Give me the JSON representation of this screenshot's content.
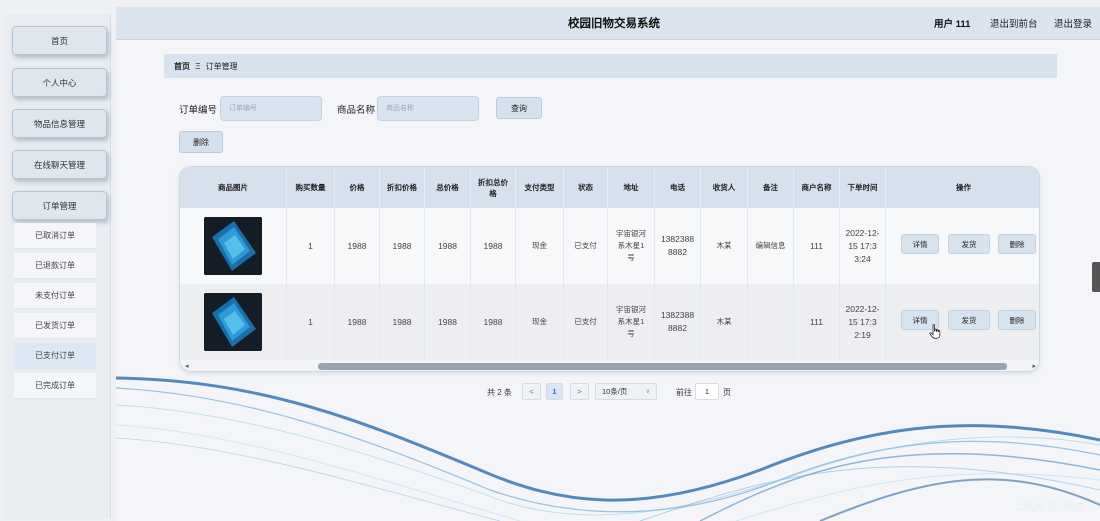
{
  "header": {
    "title": "校园旧物交易系统",
    "user": "用户 111",
    "links": [
      "退出到前台",
      "退出登录"
    ]
  },
  "sidebar": {
    "menus": [
      "首页",
      "个人中心",
      "物品信息管理",
      "在线聊天管理",
      "订单管理"
    ],
    "order_submenu": [
      "已取消订单",
      "已退款订单",
      "未支付订单",
      "已发货订单",
      "已支付订单",
      "已完成订单"
    ],
    "active_submenu": "已支付订单"
  },
  "breadcrumb": {
    "home": "首页",
    "separator": "Ξ",
    "current": "订单管理"
  },
  "search": {
    "order_no_label": "订单编号",
    "order_no_placeholder": "订单编号",
    "product_label": "商品名称",
    "product_placeholder": "商品名称",
    "query_button": "查询",
    "delete_button": "删除"
  },
  "table": {
    "columns": [
      "商品图片",
      "购买数量",
      "价格",
      "折扣价格",
      "总价格",
      "折扣总价格",
      "支付类型",
      "状态",
      "地址",
      "电话",
      "收货人",
      "备注",
      "商户名称",
      "下单时间",
      "操作"
    ],
    "rows": [
      {
        "qty": "1",
        "price": "1988",
        "discount_price": "1988",
        "total": "1988",
        "discount_total": "1988",
        "pay_type": "现金",
        "status": "已支付",
        "address": "宇宙银河系木星1号",
        "phone": "13823888882",
        "receiver": "木某",
        "remark": "编辑信息",
        "merchant": "111",
        "time": "2022-12-15 17:33:24"
      },
      {
        "qty": "1",
        "price": "1988",
        "discount_price": "1988",
        "total": "1988",
        "discount_total": "1988",
        "pay_type": "现金",
        "status": "已支付",
        "address": "宇宙银河系木星1号",
        "phone": "13823888882",
        "receiver": "木某",
        "remark": "",
        "merchant": "111",
        "time": "2022-12-15 17:32:19"
      }
    ],
    "actions": [
      "详情",
      "发货",
      "删除"
    ]
  },
  "pagination": {
    "total_text": "共 2 条",
    "current_page": "1",
    "page_size": "10条/页",
    "goto_label": "前往",
    "goto_value": "1",
    "page_unit": "页"
  },
  "watermark": "CSDN @ °迷念",
  "colors": {
    "header_bg": "#dbe4ee",
    "table_head": "#d6e1ed",
    "accent": "#2a6fc0"
  }
}
